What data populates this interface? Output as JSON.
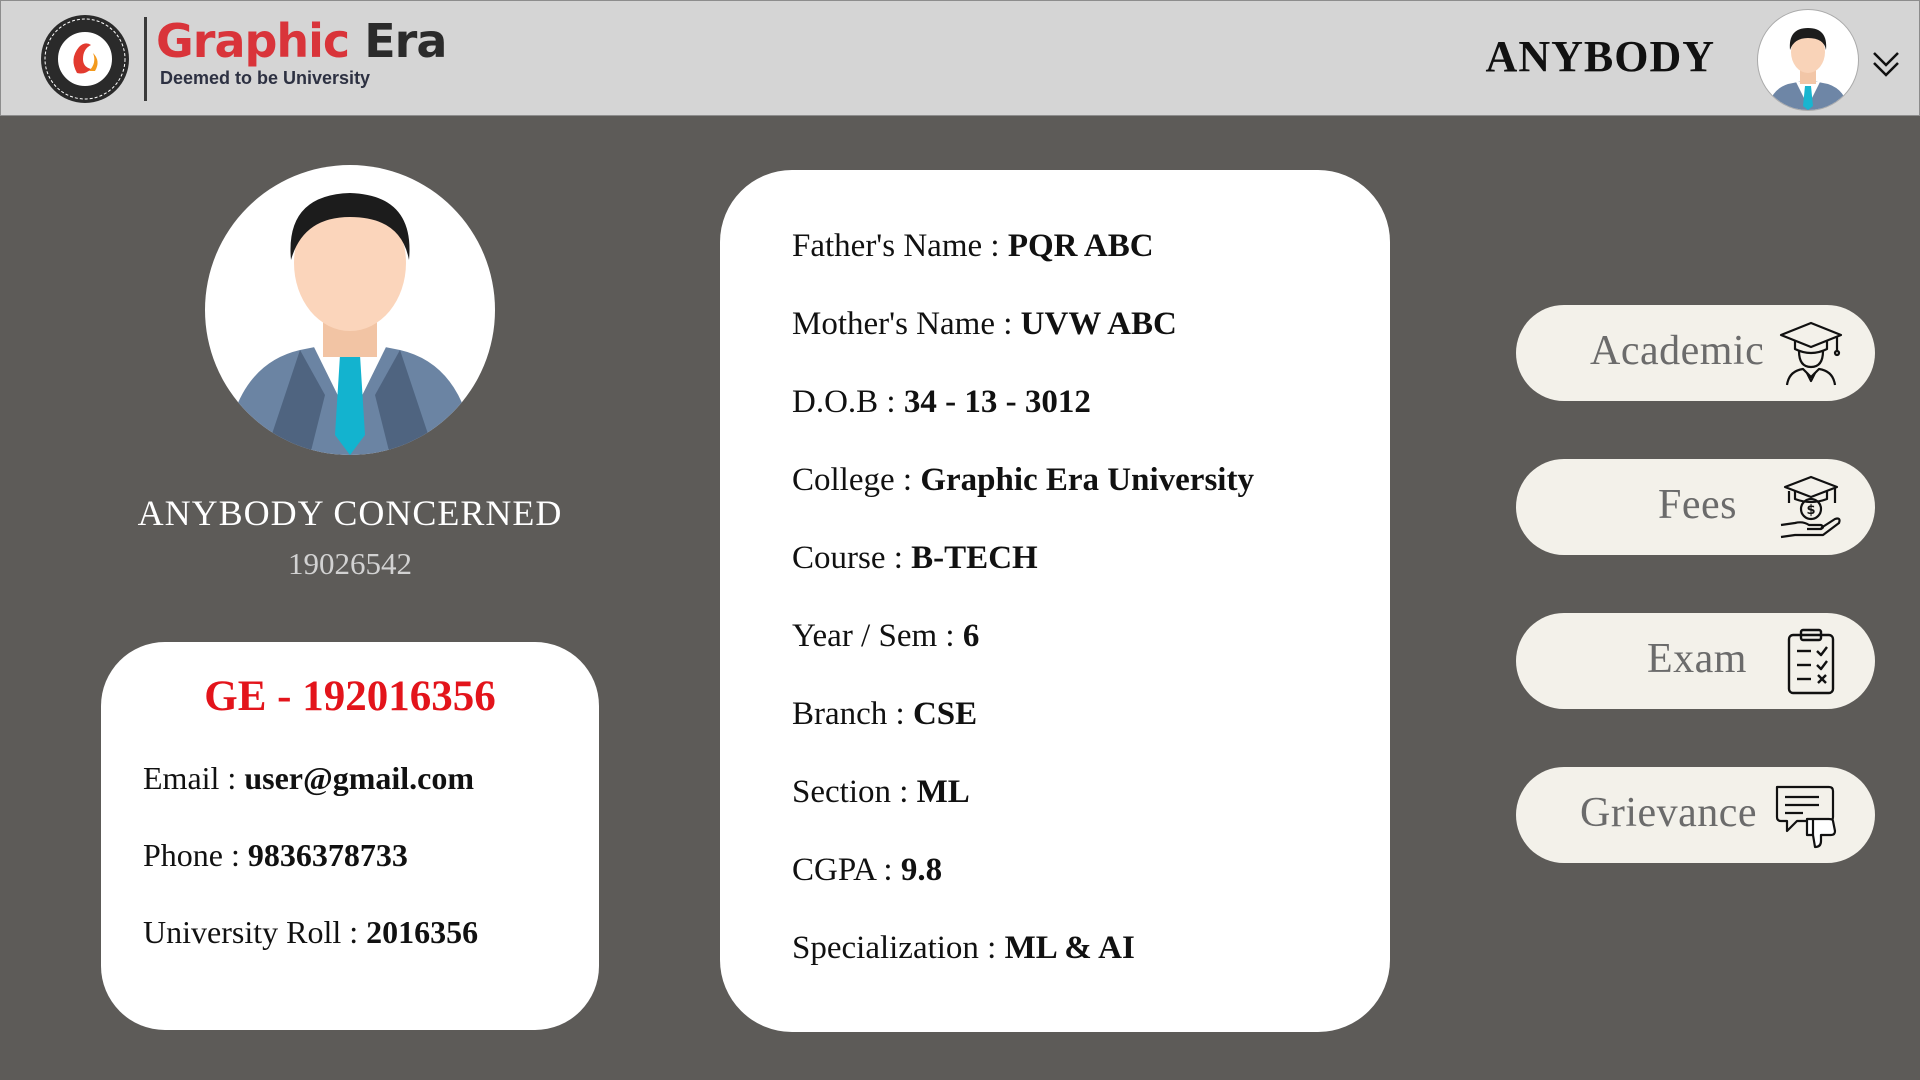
{
  "header": {
    "logo_brand_part1": "Graphic",
    "logo_brand_part2": "Era",
    "logo_subtitle": "Deemed to be University",
    "user_name": "ANYBODY",
    "avatar_icon": "user-avatar-icon",
    "dropdown_icon": "chevron-double-down-icon"
  },
  "profile": {
    "name": "ANYBODY CONCERNED",
    "student_id": "19026542"
  },
  "contact": {
    "ge_id": "GE - 192016356",
    "email_label": "Email : ",
    "email_value": "user@gmail.com",
    "phone_label": "Phone : ",
    "phone_value": "9836378733",
    "roll_label": "University Roll : ",
    "roll_value": "2016356"
  },
  "details": [
    {
      "label": "Father's Name : ",
      "value": "PQR ABC"
    },
    {
      "label": "Mother's Name : ",
      "value": "UVW ABC"
    },
    {
      "label": "D.O.B : ",
      "value": "34 - 13 - 3012"
    },
    {
      "label": "College : ",
      "value": "Graphic Era University"
    },
    {
      "label": "Course : ",
      "value": "B-TECH"
    },
    {
      "label": "Year / Sem : ",
      "value": "6"
    },
    {
      "label": "Branch : ",
      "value": "CSE"
    },
    {
      "label": "Section : ",
      "value": "ML"
    },
    {
      "label": "CGPA : ",
      "value": "9.8"
    },
    {
      "label": "Specialization : ",
      "value": "ML & AI"
    }
  ],
  "menu": [
    {
      "label": "Academic",
      "icon": "graduate-icon"
    },
    {
      "label": "Fees",
      "icon": "fees-icon"
    },
    {
      "label": "Exam",
      "icon": "clipboard-checklist-icon"
    },
    {
      "label": "Grievance",
      "icon": "feedback-dislike-icon"
    }
  ],
  "colors": {
    "background": "#5d5b58",
    "header": "#d5d5d5",
    "brand_red": "#d9343a",
    "ge_id_red": "#e3141b",
    "menu_button": "#f3f1ea"
  }
}
